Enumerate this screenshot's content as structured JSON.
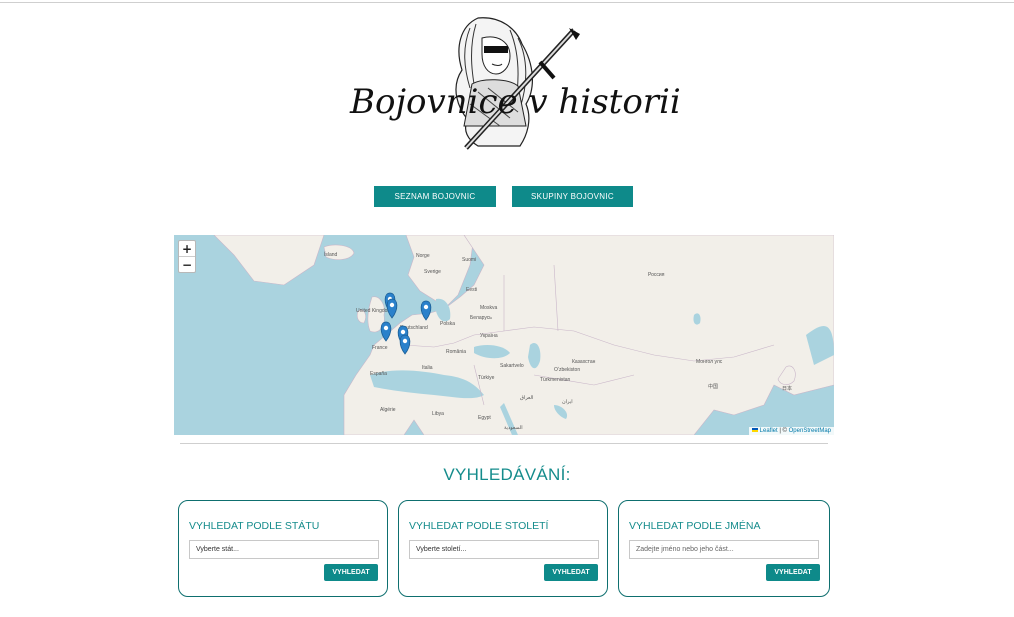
{
  "logo": {
    "text": "Bojovnice v historii"
  },
  "nav": {
    "list_label": "SEZNAM BOJOVNIC",
    "groups_label": "SKUPINY BOJOVNIC"
  },
  "map": {
    "zoom_in": "+",
    "zoom_out": "−",
    "attribution_leaflet": "Leaflet",
    "attribution_sep": " | © ",
    "attribution_osm": "OpenStreetMap",
    "labels": [
      "Ísland",
      "Norge",
      "Sverige",
      "Suomi",
      "Eesti",
      "United Kingdom",
      "Deutschland",
      "France",
      "España",
      "Italia",
      "România",
      "Polska",
      "Беларусь",
      "Україна",
      "Türkiye",
      "Россия",
      "Казахстан",
      "Монгол улс",
      "中国",
      "日本",
      "Algérie",
      "Libya",
      "Egypt",
      "ایران",
      "Türkmenistan",
      "Oʻzbekiston",
      "Moskva",
      "Sakartvelo",
      "العراق",
      "السعودية"
    ],
    "marker_count": 6
  },
  "search": {
    "title": "VYHLEDÁVÁNÍ:",
    "cards": [
      {
        "title": "VYHLEDAT PODLE STÁTU",
        "input_value": "Vyberte stát...",
        "button": "VYHLEDAT"
      },
      {
        "title": "VYHLEDAT PODLE STOLETÍ",
        "input_value": "Vyberte století...",
        "button": "VYHLEDAT"
      },
      {
        "title": "VYHLEDAT PODLE JMÉNA",
        "input_placeholder": "Zadejte jméno nebo jeho část...",
        "button": "VYHLEDAT"
      }
    ]
  },
  "colors": {
    "accent": "#0e8a8a",
    "water": "#aad3df",
    "land": "#f2efe9",
    "marker": "#2a81cb"
  }
}
